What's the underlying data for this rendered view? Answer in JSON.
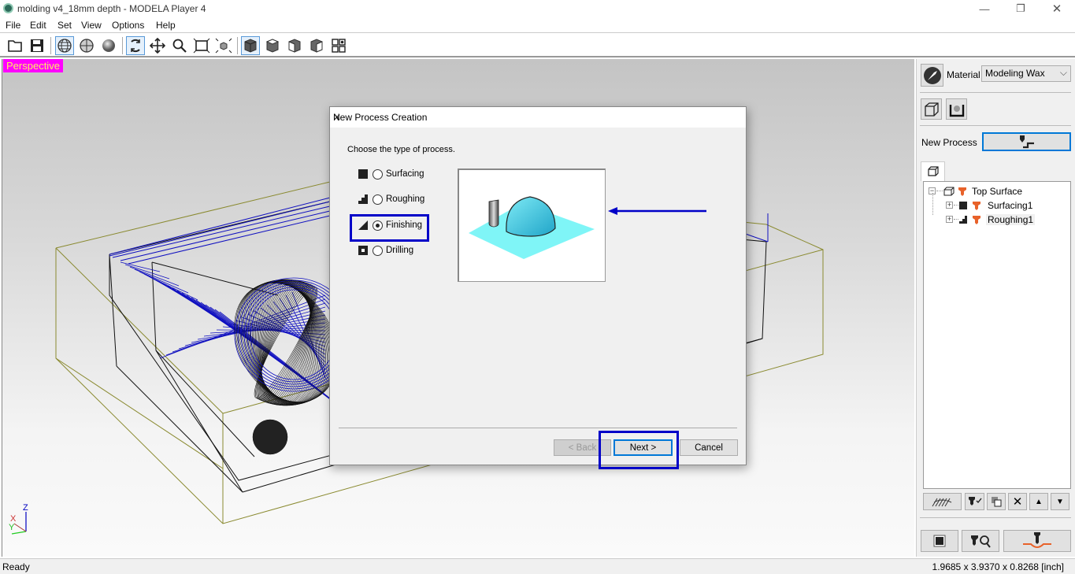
{
  "window": {
    "title": "molding v4_18mm depth  - MODELA Player 4",
    "controls": {
      "minimize": "—",
      "restore": "❐",
      "close": "✕"
    }
  },
  "menu": [
    "File",
    "Edit",
    "Set",
    "View",
    "Options",
    "Help"
  ],
  "toolbar": {
    "buttons": [
      {
        "name": "open-icon",
        "active": false
      },
      {
        "name": "save-icon",
        "active": false
      },
      {
        "name": "wireframe-view-icon",
        "active": true
      },
      {
        "name": "shaded-wire-view-icon",
        "active": false
      },
      {
        "name": "shaded-view-icon",
        "active": false
      },
      {
        "name": "rotate-icon",
        "active": true
      },
      {
        "name": "pan-icon",
        "active": false
      },
      {
        "name": "zoom-icon",
        "active": false
      },
      {
        "name": "fit-window-icon",
        "active": false
      },
      {
        "name": "fit-model-icon",
        "active": false
      },
      {
        "name": "perspective-cube-icon",
        "active": true
      },
      {
        "name": "top-view-cube-icon",
        "active": false
      },
      {
        "name": "front-view-cube-icon",
        "active": false
      },
      {
        "name": "side-view-cube-icon",
        "active": false
      },
      {
        "name": "four-views-icon",
        "active": false
      }
    ]
  },
  "viewport": {
    "label": "Perspective",
    "axes": {
      "x": "X",
      "y": "Y",
      "z": "Z"
    }
  },
  "dialog": {
    "title": "New Process Creation",
    "prompt": "Choose the type of process.",
    "options": [
      {
        "label": "Surfacing",
        "selected": false
      },
      {
        "label": "Roughing",
        "selected": false
      },
      {
        "label": "Finishing",
        "selected": true
      },
      {
        "label": "Drilling",
        "selected": false
      }
    ],
    "buttons": {
      "back": "< Back",
      "next": "Next >",
      "cancel": "Cancel"
    },
    "back_enabled": false
  },
  "right_panel": {
    "material_label": "Material",
    "material_value": "Modeling Wax",
    "new_process_label": "New Process",
    "tree": {
      "root": "Top Surface",
      "children": [
        "Surfacing1",
        "Roughing1"
      ]
    }
  },
  "status": {
    "left": "Ready",
    "dimensions": "1.9685 x 3.9370 x 0.8268 [inch]"
  },
  "colors": {
    "highlight": "#0000c8",
    "perspective_bg": "#ff00ff",
    "perspective_fg": "#ffef60",
    "toolpath": "#1010c0",
    "stock": "#8a8a30",
    "cyan": "#7ff5f7"
  }
}
